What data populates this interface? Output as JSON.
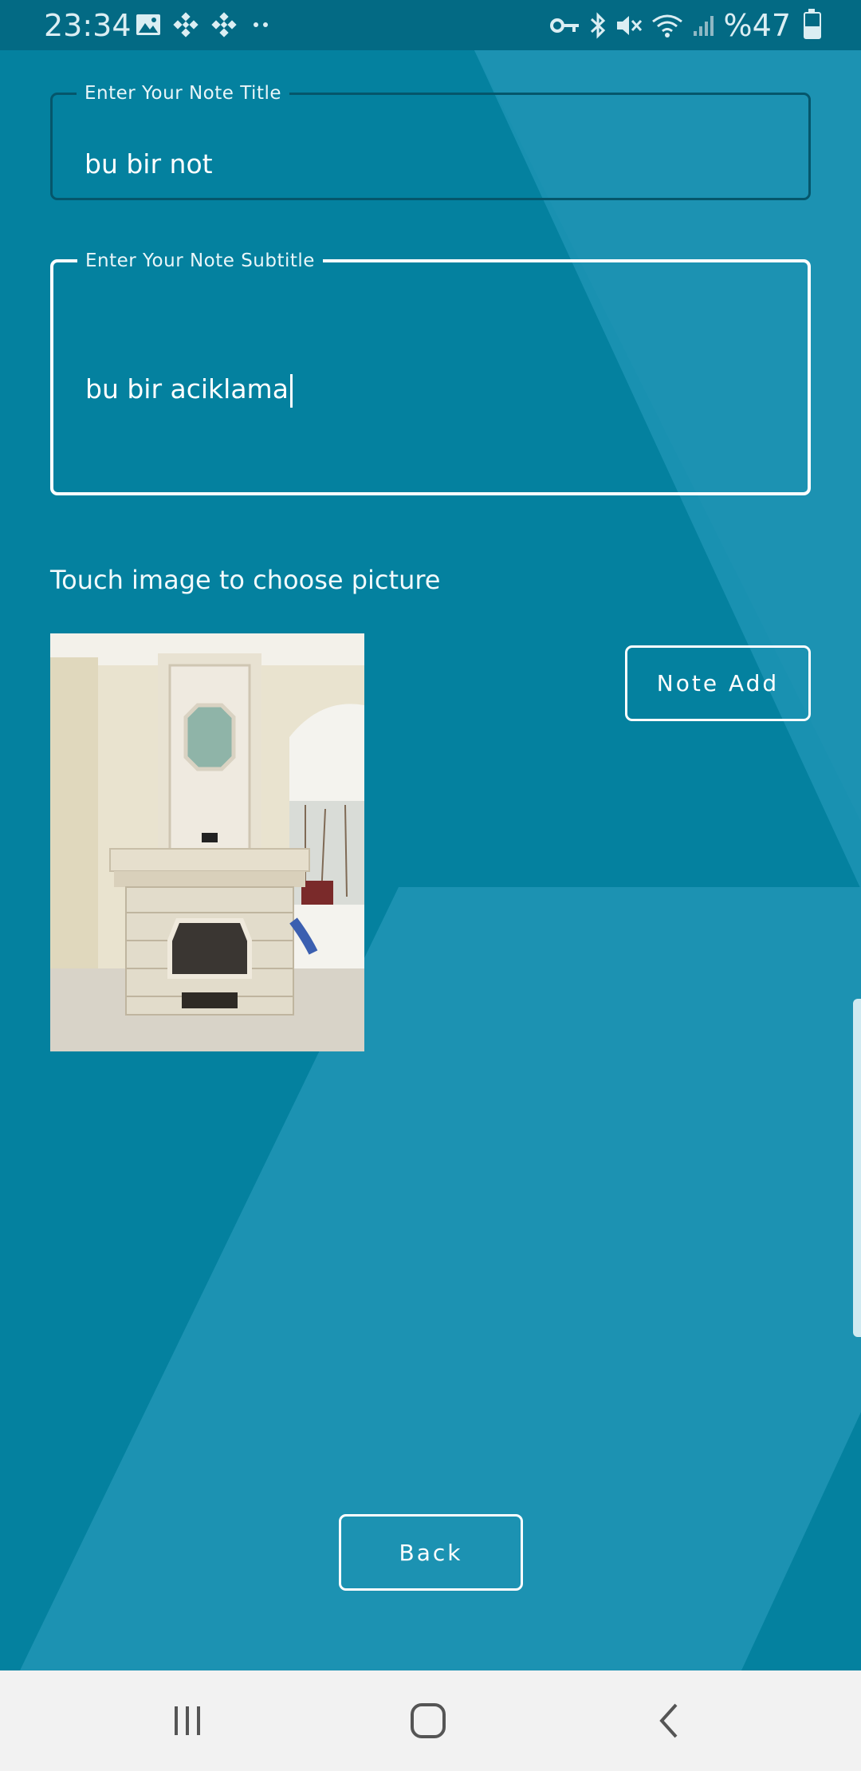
{
  "status_bar": {
    "time": "23:34",
    "battery": "%47",
    "icons_left": [
      "image-icon",
      "binance-icon",
      "binance-icon",
      "dots-icon"
    ],
    "icons_right": [
      "vpn-key-icon",
      "bluetooth-icon",
      "mute-icon",
      "wifi-icon",
      "signal-icon",
      "battery-icon"
    ],
    "battery_level": 0.47
  },
  "form": {
    "title_label": "Enter Your Note Title",
    "title_value": "bu bir not",
    "subtitle_label": "Enter Your Note Subtitle",
    "subtitle_value": "bu bir aciklama"
  },
  "image_hint": "Touch image to choose picture",
  "buttons": {
    "note_add": "Note Add",
    "back": "Back"
  },
  "navbar": [
    "recent-apps-icon",
    "home-icon",
    "back-icon"
  ],
  "colors": {
    "background": "#04819f",
    "status_bar": "#036a84",
    "accent_white": "#ffffff"
  }
}
